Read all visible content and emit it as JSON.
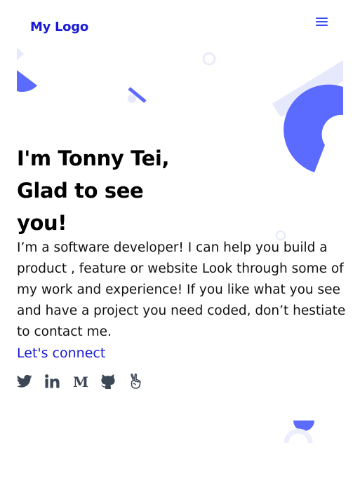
{
  "header": {
    "logo_text": "My Logo",
    "menu_icon": "hamburger-icon"
  },
  "hero": {
    "headline_lines": [
      "I'm Tonny Tei,",
      "Glad to see",
      "you!"
    ],
    "intro": "I’m a software developer! I can help you build a product , feature or website Look through some of my work and experience! If you like what you see and have a project you need coded, don’t hestiate to contact me.",
    "cta_label": "Let's connect"
  },
  "socials": [
    {
      "icon": "twitter-icon"
    },
    {
      "icon": "linkedin-icon"
    },
    {
      "icon": "medium-icon"
    },
    {
      "icon": "github-icon"
    },
    {
      "icon": "peace-hand-icon"
    }
  ],
  "colors": {
    "brand": "#1a1ad6",
    "accent": "#5c6bff",
    "accent_light": "#e6e8fc",
    "icon": "#3d4856"
  }
}
